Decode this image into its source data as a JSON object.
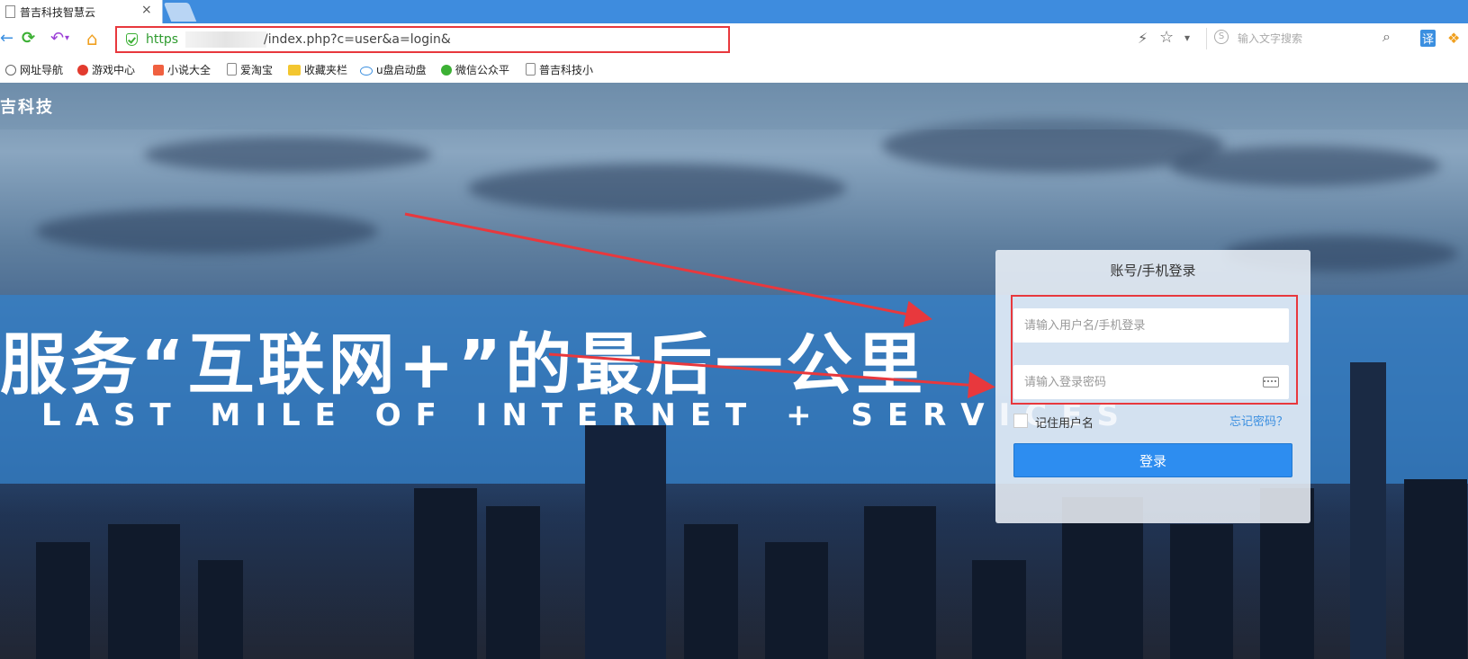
{
  "browser": {
    "tab_title": "普吉科技智慧云",
    "tab_close": "×",
    "url_scheme": "https",
    "url_path": "/index.php?c=user&a=login&",
    "search_placeholder": "输入文字搜索",
    "icons": {
      "back": "←",
      "refresh": "⟳",
      "undo": "↶",
      "home": "⌂",
      "bolt": "⚡",
      "star": "☆",
      "dropdown": "▾",
      "search": "⌕",
      "translate": "译",
      "extension": "❖"
    },
    "bookmarks": [
      {
        "label": "网址导航"
      },
      {
        "label": "游戏中心"
      },
      {
        "label": "小说大全"
      },
      {
        "label": "爱淘宝"
      },
      {
        "label": "收藏夹栏"
      },
      {
        "label": "u盘启动盘"
      },
      {
        "label": "微信公众平"
      },
      {
        "label": "普吉科技小"
      }
    ]
  },
  "site": {
    "brand": "吉科技",
    "hero_title": "服务“互联网+”的最后一公里",
    "hero_subtitle": "LAST MILE OF INTERNET + SERVICES"
  },
  "login": {
    "title": "账号/手机登录",
    "username_placeholder": "请输入用户名/手机登录",
    "password_placeholder": "请输入登录密码",
    "remember_label": "记住用户名",
    "forgot_label": "忘记密码？",
    "submit_label": "登录"
  },
  "colors": {
    "annotation_red": "#e8383d",
    "login_button": "#2d8df0",
    "tab_bar": "#3e8cde"
  }
}
